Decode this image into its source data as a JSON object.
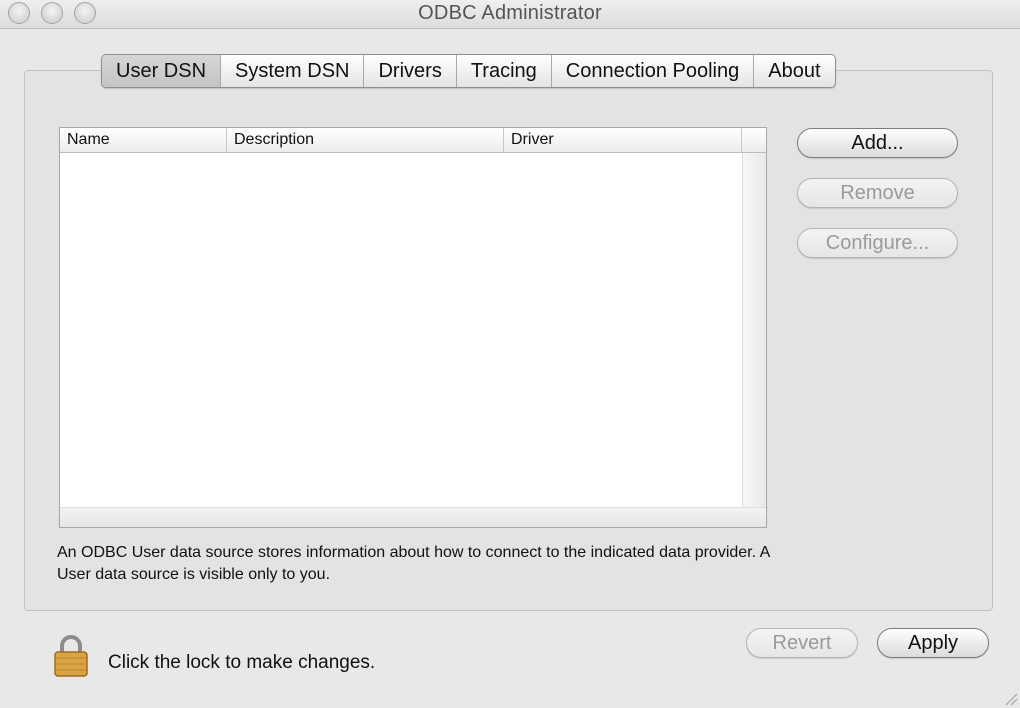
{
  "window": {
    "title": "ODBC Administrator"
  },
  "tabs": [
    {
      "label": "User DSN",
      "selected": true
    },
    {
      "label": "System DSN",
      "selected": false
    },
    {
      "label": "Drivers",
      "selected": false
    },
    {
      "label": "Tracing",
      "selected": false
    },
    {
      "label": "Connection Pooling",
      "selected": false
    },
    {
      "label": "About",
      "selected": false
    }
  ],
  "table": {
    "columns": [
      "Name",
      "Description",
      "Driver"
    ],
    "rows": []
  },
  "buttons": {
    "add": "Add...",
    "remove": "Remove",
    "configure": "Configure...",
    "revert": "Revert",
    "apply": "Apply"
  },
  "description": "An ODBC User data source stores information about how to connect to the indicated data provider. A User data source is visible only to you.",
  "lock": {
    "message": "Click the lock to make changes.",
    "icon": "padlock-icon"
  },
  "icons": {
    "close": "close-button-icon",
    "minimize": "minimize-button-icon",
    "zoom": "zoom-button-icon",
    "resize": "resize-grip-icon"
  },
  "colors": {
    "window_bg": "#e8e8e8",
    "lock_gold": "#d9a441"
  }
}
